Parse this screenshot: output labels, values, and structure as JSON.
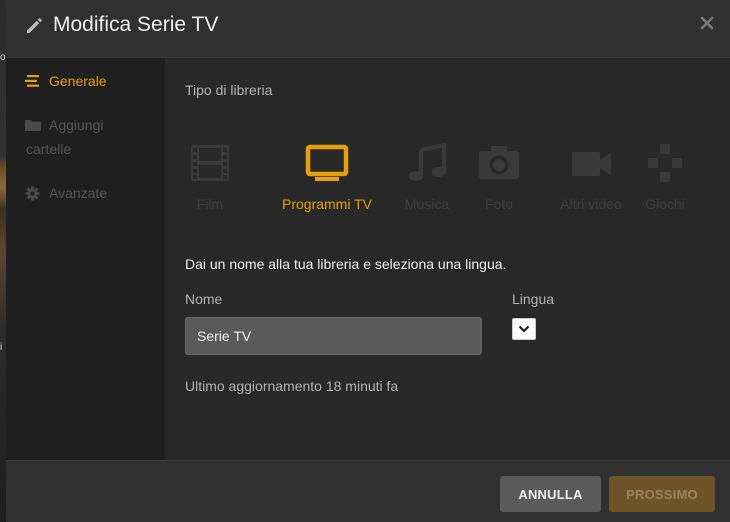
{
  "header": {
    "title": "Modifica Serie TV"
  },
  "background": {
    "fragment_top": "o",
    "fragment_mid": "i"
  },
  "sidebar": {
    "items": [
      {
        "label": "Generale",
        "icon": "list-icon",
        "active": true
      },
      {
        "label": "Aggiungi cartelle",
        "icon": "folder-icon",
        "active": false
      },
      {
        "label": "Avanzate",
        "icon": "gear-icon",
        "active": false
      }
    ]
  },
  "content": {
    "section_label": "Tipo di libreria",
    "library_types": [
      {
        "label": "Film",
        "icon": "film-icon",
        "selected": false
      },
      {
        "label": "Programmi TV",
        "icon": "tv-icon",
        "selected": true
      },
      {
        "label": "Musica",
        "icon": "music-icon",
        "selected": false
      },
      {
        "label": "Foto",
        "icon": "camera-icon",
        "selected": false
      },
      {
        "label": "Altri video",
        "icon": "video-camera-icon",
        "selected": false
      },
      {
        "label": "Giochi",
        "icon": "gamepad-icon",
        "selected": false
      }
    ],
    "prompt": "Dai un nome alla tua libreria e seleziona una lingua.",
    "name_label": "Nome",
    "name_value": "Serie TV",
    "language_label": "Lingua",
    "language_value": "",
    "last_updated": "Ultimo aggiornamento 18 minuti fa"
  },
  "footer": {
    "cancel_label": "ANNULLA",
    "next_label": "PROSSIMO"
  },
  "colors": {
    "accent": "#e5a00d",
    "inactive_icon": "#3e3e3e",
    "background": "#282828",
    "sidebar": "#1f1f1f"
  }
}
